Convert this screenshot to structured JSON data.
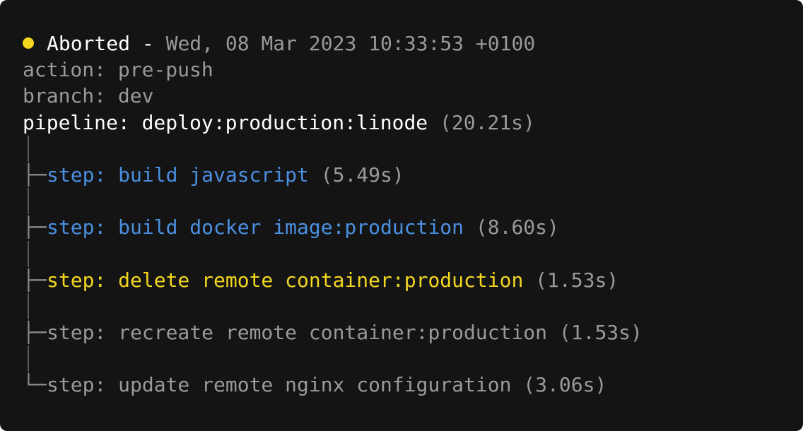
{
  "header": {
    "status_label": "Aborted",
    "separator": " - ",
    "timestamp": "Wed, 08 Mar 2023 10:33:53 +0100"
  },
  "action": {
    "key": "action: ",
    "value": "pre-push"
  },
  "branch": {
    "key": "branch: ",
    "value": "dev"
  },
  "pipeline": {
    "label": "pipeline: deploy:production:linode",
    "duration": " (20.21s)"
  },
  "steps": [
    {
      "connector": "├─",
      "label": "step: build javascript",
      "duration": " (5.49s)",
      "state": "completed"
    },
    {
      "connector": "├─",
      "label": "step: build docker image:production",
      "duration": " (8.60s)",
      "state": "completed"
    },
    {
      "connector": "├─",
      "label": "step: delete remote container:production",
      "duration": " (1.53s)",
      "state": "aborted"
    },
    {
      "connector": "├─",
      "label": "step: recreate remote container:production",
      "duration": " (1.53s)",
      "state": "skipped"
    },
    {
      "connector": "└─",
      "label": "step: update remote nginx configuration",
      "duration": " (3.06s)",
      "state": "skipped"
    }
  ],
  "colors": {
    "background": "#141414",
    "completed": "#4a8fe0",
    "aborted": "#f2d61f",
    "skipped": "#9a9a9a",
    "status_dot": "#f2d61f"
  }
}
